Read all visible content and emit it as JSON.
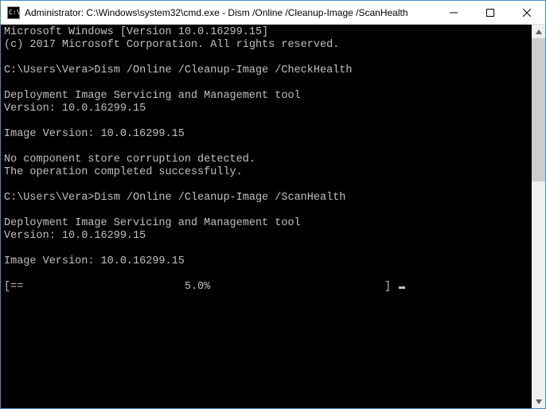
{
  "titlebar": {
    "title": "Administrator: C:\\Windows\\system32\\cmd.exe - Dism  /Online /Cleanup-Image /ScanHealth"
  },
  "terminal": {
    "lines": {
      "l0": "Microsoft Windows [Version 10.0.16299.15]",
      "l1": "(c) 2017 Microsoft Corporation. All rights reserved.",
      "l2": "",
      "l3_prompt": "C:\\Users\\Vera>",
      "l3_cmd": "Dism /Online /Cleanup-Image /CheckHealth",
      "l4": "",
      "l5": "Deployment Image Servicing and Management tool",
      "l6": "Version: 10.0.16299.15",
      "l7": "",
      "l8": "Image Version: 10.0.16299.15",
      "l9": "",
      "l10": "No component store corruption detected.",
      "l11": "The operation completed successfully.",
      "l12": "",
      "l13_prompt": "C:\\Users\\Vera>",
      "l13_cmd": "Dism /Online /Cleanup-Image /ScanHealth",
      "l14": "",
      "l15": "Deployment Image Servicing and Management tool",
      "l16": "Version: 10.0.16299.15",
      "l17": "",
      "l18": "Image Version: 10.0.16299.15",
      "l19": "",
      "progress_bar": "[==                         5.0%                           ] "
    }
  },
  "progress": {
    "percent": 5.0
  }
}
